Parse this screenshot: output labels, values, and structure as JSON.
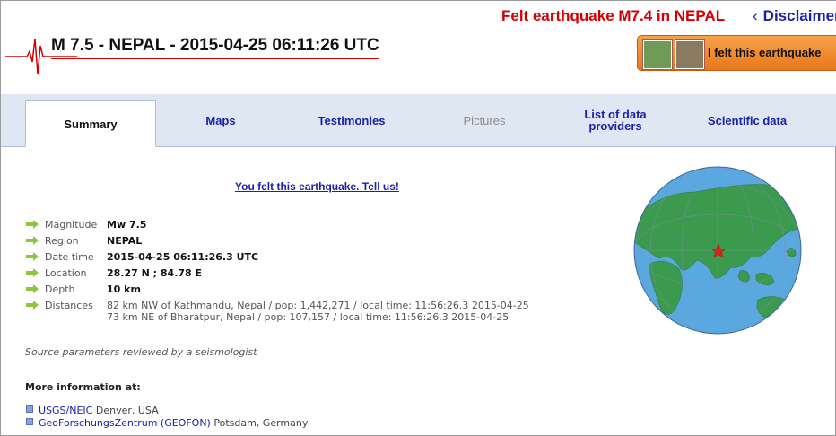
{
  "header": {
    "felt_title": "Felt earthquake M7.4 in NEPAL",
    "disclaimer": "Disclaimer",
    "quake_title": "M 7.5 - NEPAL - 2015-04-25 06:11:26 UTC",
    "felt_button": "I felt this earthquake"
  },
  "tabs": [
    {
      "label": "Summary",
      "state": "active"
    },
    {
      "label": "Maps",
      "state": "normal"
    },
    {
      "label": "Testimonies",
      "state": "normal"
    },
    {
      "label": "Pictures",
      "state": "disabled"
    },
    {
      "label": "List of data providers",
      "state": "normal"
    },
    {
      "label": "Scientific data",
      "state": "normal"
    }
  ],
  "tell_us_link": "You felt this earthquake. Tell us!",
  "params": [
    {
      "label": "Magnitude",
      "value": "Mw 7.5"
    },
    {
      "label": "Region",
      "value": "NEPAL"
    },
    {
      "label": "Date time",
      "value": "2015-04-25 06:11:26.3 UTC"
    },
    {
      "label": "Location",
      "value": "28.27 N ; 84.78 E"
    },
    {
      "label": "Depth",
      "value": "10 km"
    }
  ],
  "distances": {
    "label": "Distances",
    "lines": [
      "82 km NW of Kathmandu, Nepal / pop: 1,442,271 / local time: 11:56:26.3 2015-04-25",
      "73 km NE of Bharatpur, Nepal / pop: 107,157 / local time: 11:56:26.3 2015-04-25"
    ]
  },
  "source_note": "Source parameters reviewed by a seismologist",
  "more_info": {
    "heading": "More information at:",
    "links": [
      {
        "name": "USGS/NEIC",
        "place": "Denver, USA"
      },
      {
        "name": "GeoForschungsZentrum (GEOFON)",
        "place": "Potsdam, Germany"
      }
    ]
  },
  "colors": {
    "accent_red": "#d40000",
    "link_blue": "#1a22a8",
    "tab_bg": "#dfe7f3",
    "ocean": "#5aa8e0",
    "land": "#3c9a4e",
    "epicenter": "#e02020"
  },
  "icons": {
    "seismogram": "seismogram-icon",
    "arrow": "green-arrow-icon",
    "globe": "globe-map-icon",
    "epicenter": "star-icon"
  }
}
